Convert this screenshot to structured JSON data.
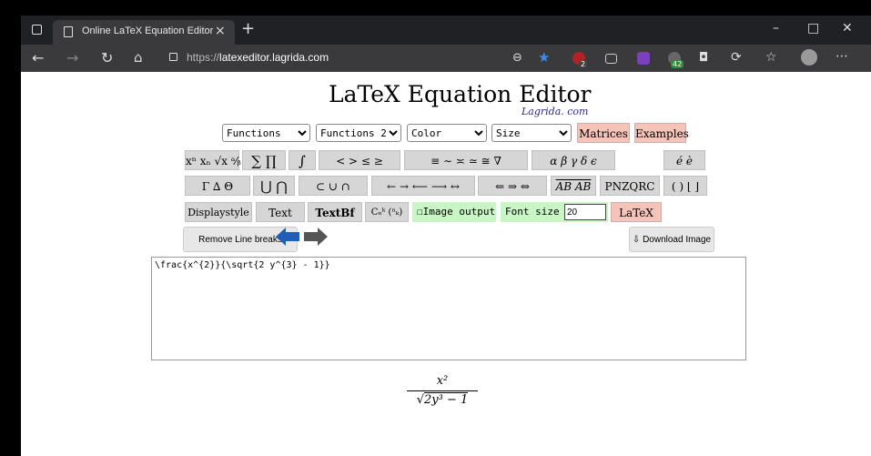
{
  "browser": {
    "tab_title": "Online LaTeX Equation Editor",
    "tab_close": "×",
    "new_tab": "+",
    "url_prefix": "https://",
    "url_host": "latexeditor.lagrida.com",
    "window_controls": [
      "–",
      "□",
      "✕"
    ],
    "nav_icons": [
      "back-icon",
      "forward-icon",
      "refresh-icon",
      "home-icon"
    ],
    "ext_badges": [
      "2",
      "42"
    ]
  },
  "page": {
    "title_latex": "LaTeX",
    "title_rest": " Equation Editor",
    "subbrand": "Lagrida. com",
    "selects": [
      {
        "selected": "Functions"
      },
      {
        "selected": "Functions 2"
      },
      {
        "selected": "Color"
      },
      {
        "selected": "Size"
      }
    ],
    "pink_buttons": [
      "Matrices",
      "Examples"
    ],
    "row1": [
      "xⁿ  xₙ  √x  ᵃ⁄ᵦ",
      "∑ ∏",
      "∫",
      "<  >  ≤  ≥",
      "≡  ∼  ≍  ≃  ≅  ∇",
      "α  β  γ  δ  ϵ",
      "é  è"
    ],
    "row2": [
      "Γ  ∆  Θ",
      "⋃ ⋂",
      "⊂  ∪  ∩",
      "←  →  ⟵  ⟶  ↔",
      "⇐  ⇒  ⇔",
      "AB AB",
      "PNZQRC",
      "( ) ⌊ ⌋"
    ],
    "row3": {
      "displaystyle": "Displaystyle",
      "text": "Text",
      "textbf": "TextBf",
      "binom": "Cₙᵏ (ⁿₖ)",
      "image_output": "Image output",
      "font_size_label": "Font size",
      "font_size_value": "20",
      "latex_button": "LaTeX"
    },
    "remove_line_breaks": "Remove Line breaks",
    "download_image": "Download Image",
    "editor_text": "\\frac{x^{2}}{\\sqrt{2 y^{3} - 1}}",
    "rendered": {
      "numerator": "x²",
      "radical": "√",
      "denominator": "2y³ − 1"
    },
    "colors": {
      "pink": "#f6c3b8",
      "green": "#c8f7c5",
      "gray": "#d6d6d6",
      "brand": "#2b2a8c"
    }
  }
}
